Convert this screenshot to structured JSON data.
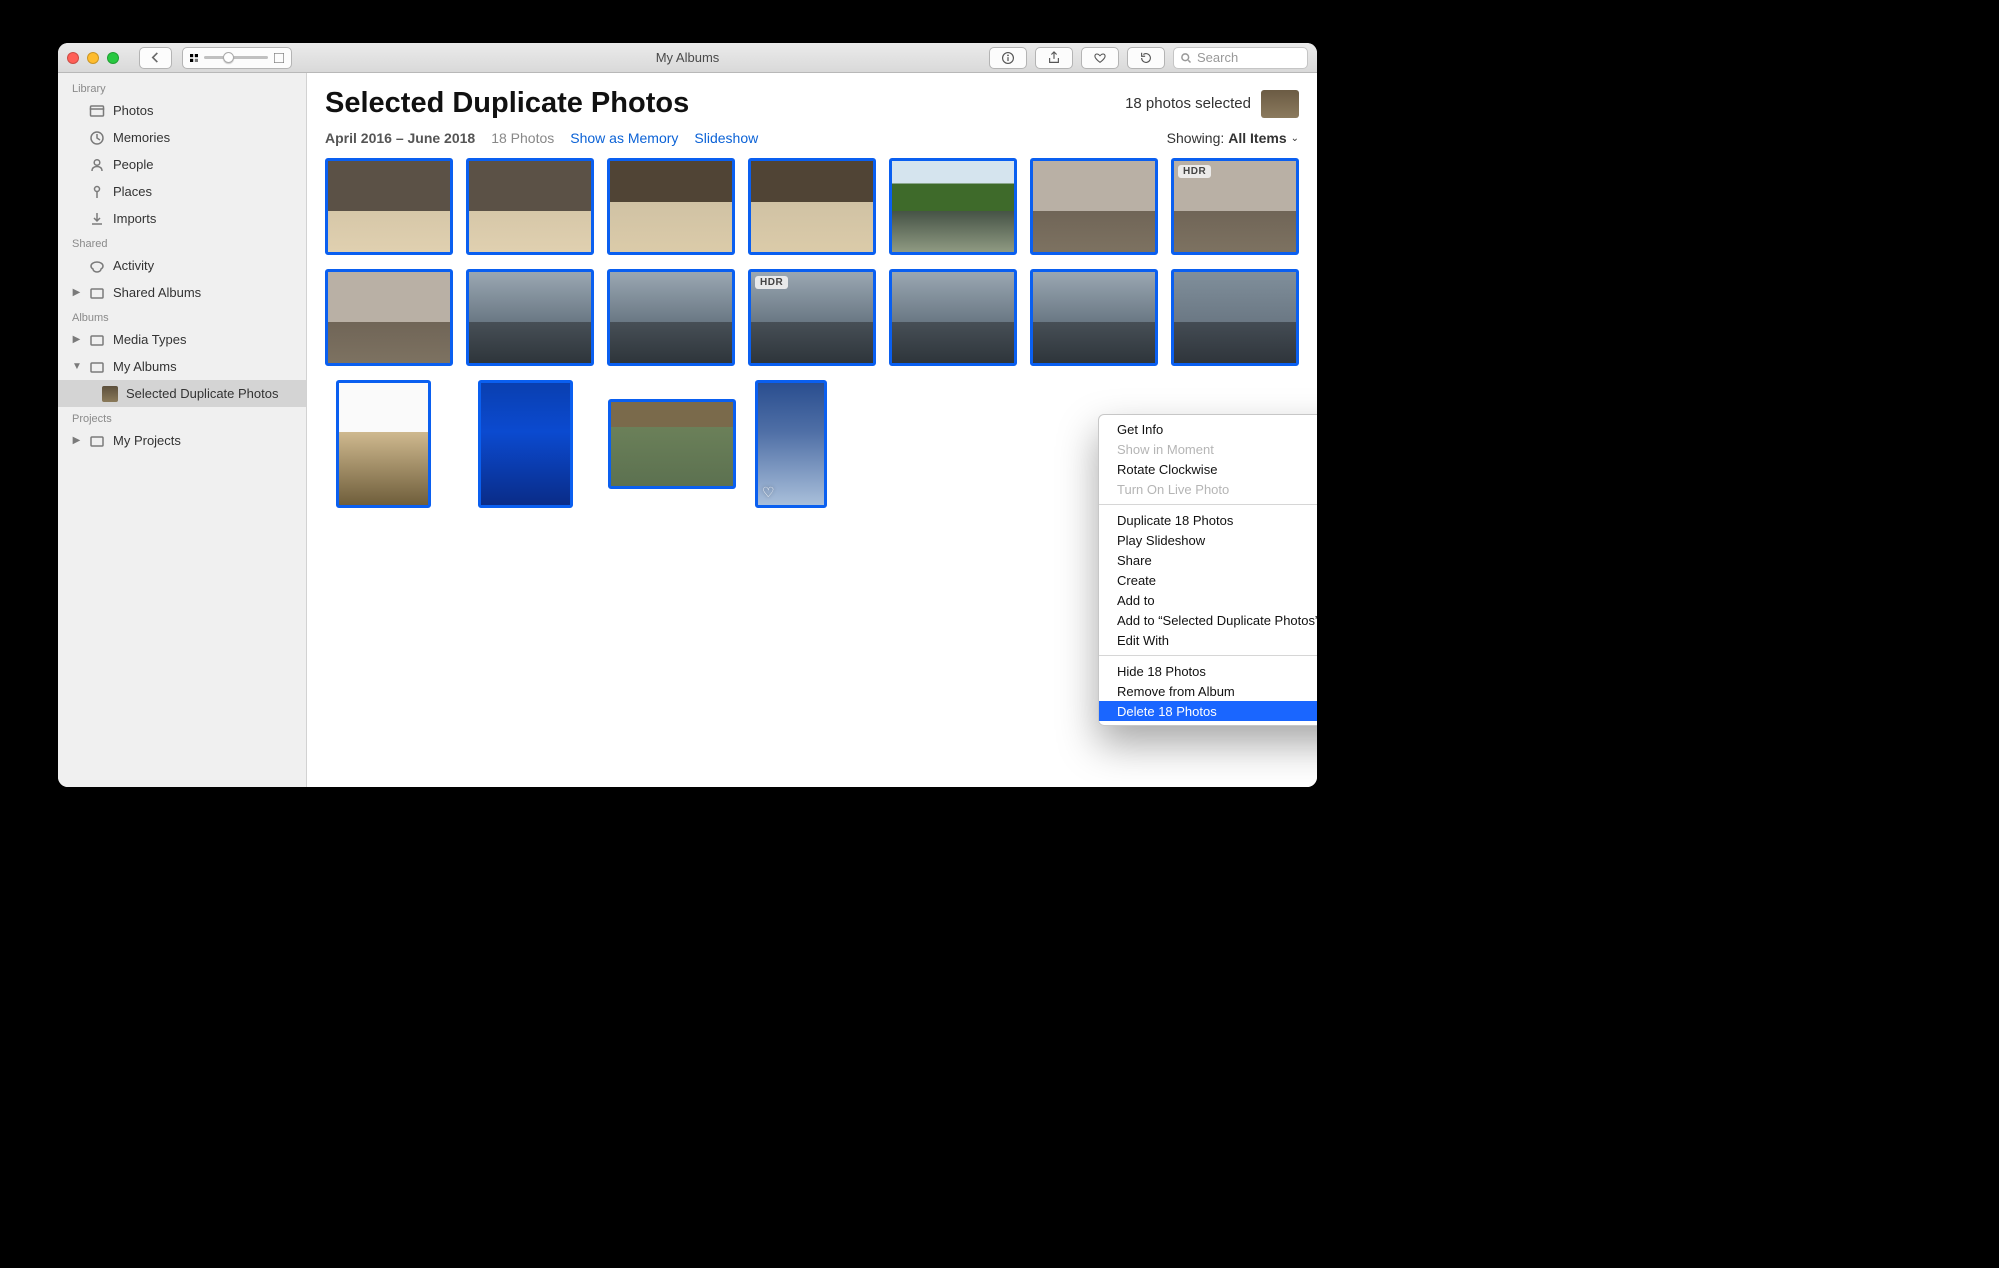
{
  "titlebar": {
    "title": "My Albums",
    "search_placeholder": "Search"
  },
  "sidebar": {
    "sections": [
      "Library",
      "Shared",
      "Albums",
      "Projects"
    ],
    "library": [
      "Photos",
      "Memories",
      "People",
      "Places",
      "Imports"
    ],
    "shared": [
      "Activity",
      "Shared Albums"
    ],
    "albums": [
      "Media Types",
      "My Albums",
      "Selected Duplicate Photos"
    ],
    "projects": [
      "My Projects"
    ]
  },
  "main": {
    "title": "Selected Duplicate Photos",
    "selection_text": "18 photos selected",
    "date_range": "April 2016 – June 2018",
    "count_text": "18 Photos",
    "links": [
      "Show as Memory",
      "Slideshow"
    ],
    "showing_label": "Showing:",
    "showing_value": "All Items",
    "badges": {
      "hdr": "HDR"
    }
  },
  "context_menu": [
    {
      "label": "Get Info"
    },
    {
      "label": "Show in Moment"
    },
    {
      "label": "Rotate Clockwise"
    },
    {
      "label": "Turn On Live Photo"
    },
    {
      "label": "Duplicate 18 Photos"
    },
    {
      "label": "Play Slideshow"
    },
    {
      "label": "Share"
    },
    {
      "label": "Create"
    },
    {
      "label": "Add to"
    },
    {
      "label": "Add to “Selected Duplicate Photos”"
    },
    {
      "label": "Edit With"
    },
    {
      "label": "Hide 18 Photos"
    },
    {
      "label": "Remove from Album"
    },
    {
      "label": "Delete 18 Photos"
    }
  ]
}
